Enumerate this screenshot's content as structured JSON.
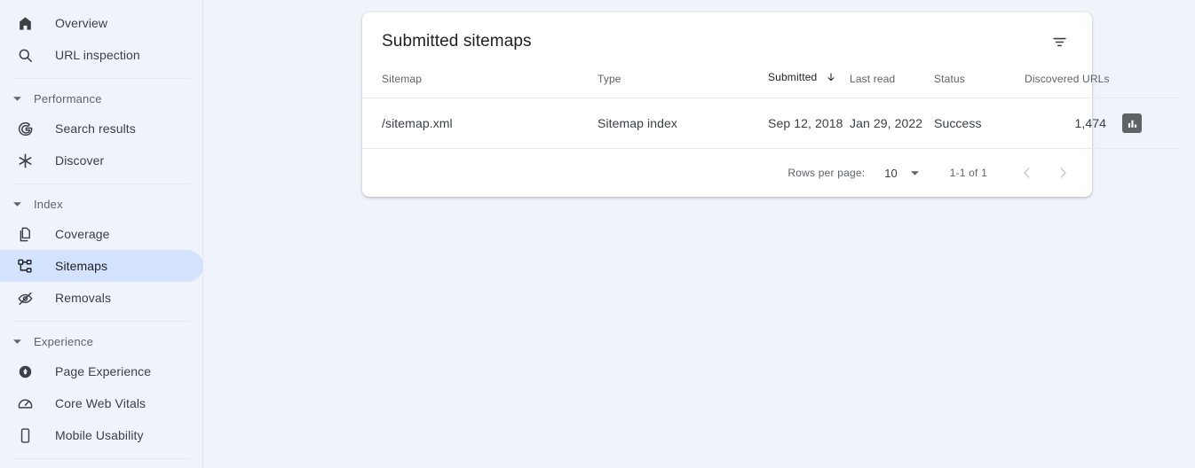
{
  "sidebar": {
    "top_items": [
      {
        "label": "Overview",
        "icon": "home-icon",
        "id": "overview"
      },
      {
        "label": "URL inspection",
        "icon": "search-icon",
        "id": "url-inspection"
      }
    ],
    "groups": [
      {
        "name": "Performance",
        "id": "performance",
        "items": [
          {
            "label": "Search results",
            "icon": "google-g-icon",
            "id": "search-results"
          },
          {
            "label": "Discover",
            "icon": "asterisk-icon",
            "id": "discover"
          }
        ]
      },
      {
        "name": "Index",
        "id": "index",
        "items": [
          {
            "label": "Coverage",
            "icon": "pages-icon",
            "id": "coverage"
          },
          {
            "label": "Sitemaps",
            "icon": "sitemap-tree-icon",
            "id": "sitemaps",
            "active": true
          },
          {
            "label": "Removals",
            "icon": "eye-off-icon",
            "id": "removals"
          }
        ]
      },
      {
        "name": "Experience",
        "id": "experience",
        "items": [
          {
            "label": "Page Experience",
            "icon": "page-experience-icon",
            "id": "page-experience"
          },
          {
            "label": "Core Web Vitals",
            "icon": "speedometer-icon",
            "id": "core-web-vitals"
          },
          {
            "label": "Mobile Usability",
            "icon": "mobile-icon",
            "id": "mobile-usability"
          }
        ]
      }
    ]
  },
  "card": {
    "title": "Submitted sitemaps",
    "filter_icon": "filter-list-icon",
    "columns": [
      {
        "key": "sitemap",
        "label": "Sitemap"
      },
      {
        "key": "type",
        "label": "Type"
      },
      {
        "key": "submitted",
        "label": "Submitted",
        "sorted": true,
        "sort_direction": "desc",
        "sort_icon": "arrow-down-icon"
      },
      {
        "key": "last_read",
        "label": "Last read"
      },
      {
        "key": "status",
        "label": "Status"
      },
      {
        "key": "discovered_urls",
        "label": "Discovered URLs"
      }
    ],
    "rows": [
      {
        "sitemap": "/sitemap.xml",
        "type": "Sitemap index",
        "submitted": "Sep 12, 2018",
        "last_read": "Jan 29, 2022",
        "status": "Success",
        "status_color": "#188038",
        "discovered_urls": "1,474",
        "action_icon": "bar-chart-icon"
      }
    ],
    "pagination": {
      "rows_per_page_label": "Rows per page:",
      "rows_per_page_value": "10",
      "dropdown_icon": "chevron-down-icon",
      "range": "1-1 of 1",
      "prev_icon": "chevron-left-icon",
      "next_icon": "chevron-right-icon"
    }
  },
  "theme": {
    "page_bg": "#f1f3fb",
    "card_bg": "#ffffff",
    "active_pill": "#d3e3fd",
    "success_green": "#188038",
    "text_primary": "#202124",
    "text_secondary": "#5f6368"
  }
}
